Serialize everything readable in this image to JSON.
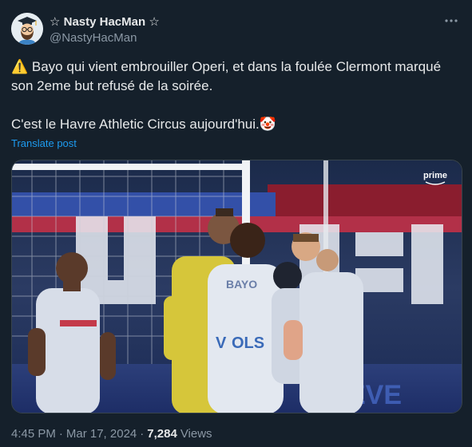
{
  "author": {
    "display_name": "☆ Nasty HacMan ☆",
    "handle": "@NastyHacMan"
  },
  "post": {
    "line1": "⚠️ Bayo qui vient embrouiller Operi, et dans la foulée Clermont marqué son 2eme but refusé de la soirée.",
    "line2": "C'est le Havre Athletic Circus aujourd'hui.🤡",
    "translate_label": "Translate post"
  },
  "media": {
    "broadcaster_logo": "prime",
    "jersey_name": "BAYO"
  },
  "meta": {
    "time": "4:45 PM",
    "date": "Mar 17, 2024",
    "separator": "·",
    "views_count": "7,284",
    "views_label": "Views"
  },
  "icons": {
    "more": "more-options-icon"
  },
  "colors": {
    "background": "#15202b",
    "text": "#e7e9ea",
    "secondary": "#8b98a5",
    "link": "#1d9bf0"
  }
}
